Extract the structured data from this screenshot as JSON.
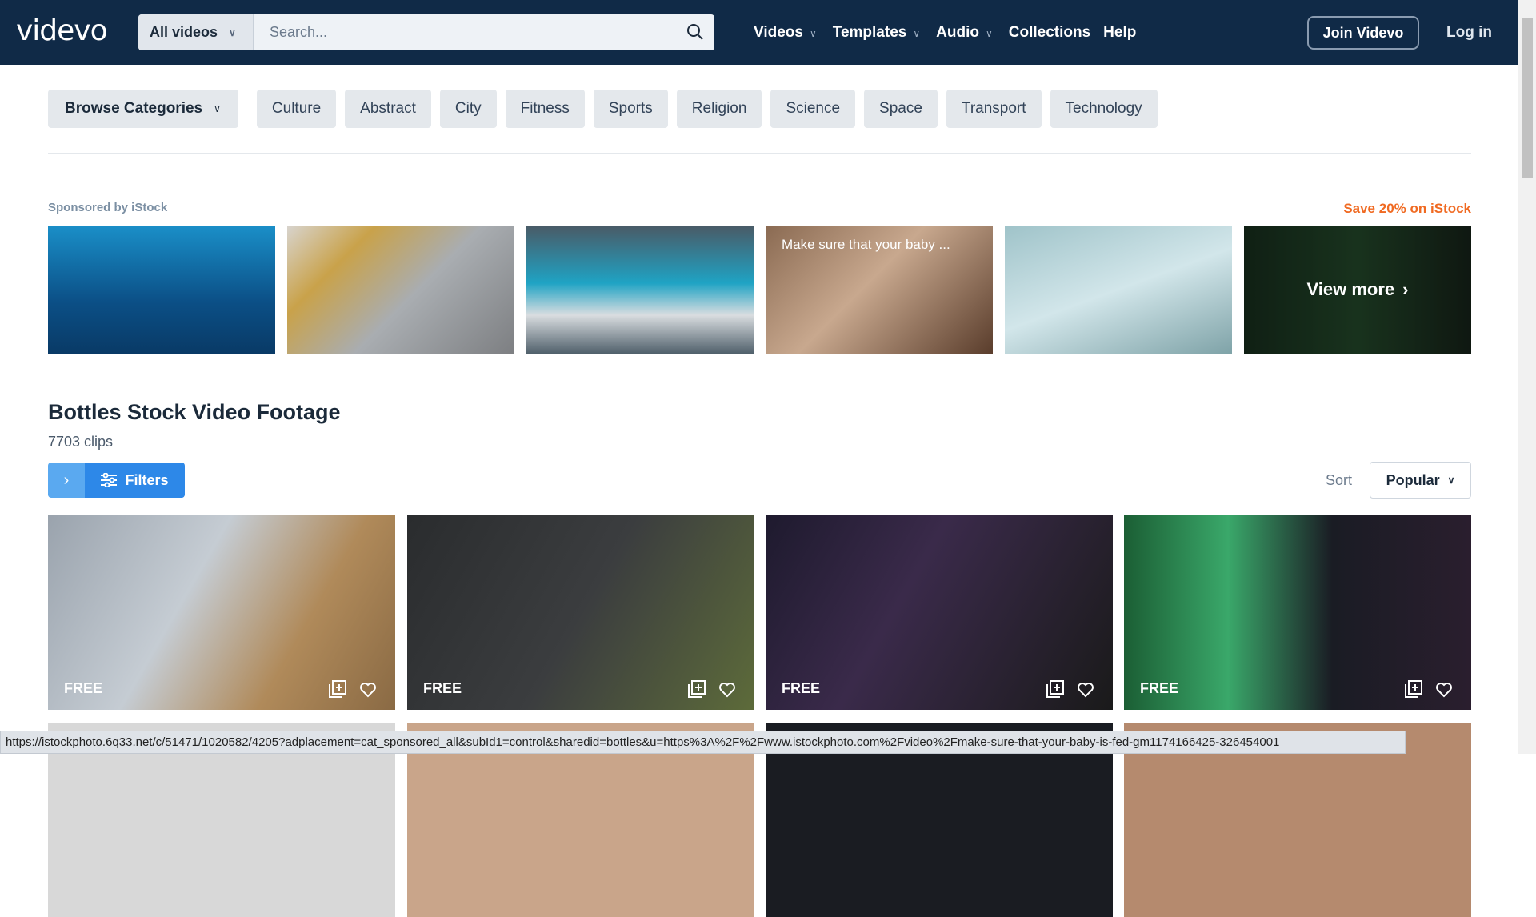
{
  "header": {
    "logo": "videvo",
    "search_scope": "All videos",
    "search_placeholder": "Search...",
    "nav": [
      "Videos",
      "Templates",
      "Audio",
      "Collections",
      "Help"
    ],
    "join": "Join Videvo",
    "login": "Log in"
  },
  "categories": {
    "browse": "Browse Categories",
    "items": [
      "Culture",
      "Abstract",
      "City",
      "Fitness",
      "Sports",
      "Religion",
      "Science",
      "Space",
      "Transport",
      "Technology"
    ]
  },
  "sponsored": {
    "label": "Sponsored by iStock",
    "save_link": "Save 20% on iStock",
    "item4_title": "Make sure that your baby ...",
    "view_more": "View more"
  },
  "main": {
    "title": "Bottles Stock Video Footage",
    "clips": "7703 clips",
    "filters": "Filters",
    "sort_label": "Sort",
    "sort_value": "Popular",
    "badge": "FREE"
  },
  "status_url": "https://istockphoto.6q33.net/c/51471/1020582/4205?adplacement=cat_sponsored_all&subId1=control&sharedid=bottles&u=https%3A%2F%2Fwww.istockphoto.com%2Fvideo%2Fmake-sure-that-your-baby-is-fed-gm1174166425-326454001",
  "colors": {
    "nav_bg": "#102a47",
    "accent": "#2d88e8",
    "save_link": "#f06a22"
  }
}
